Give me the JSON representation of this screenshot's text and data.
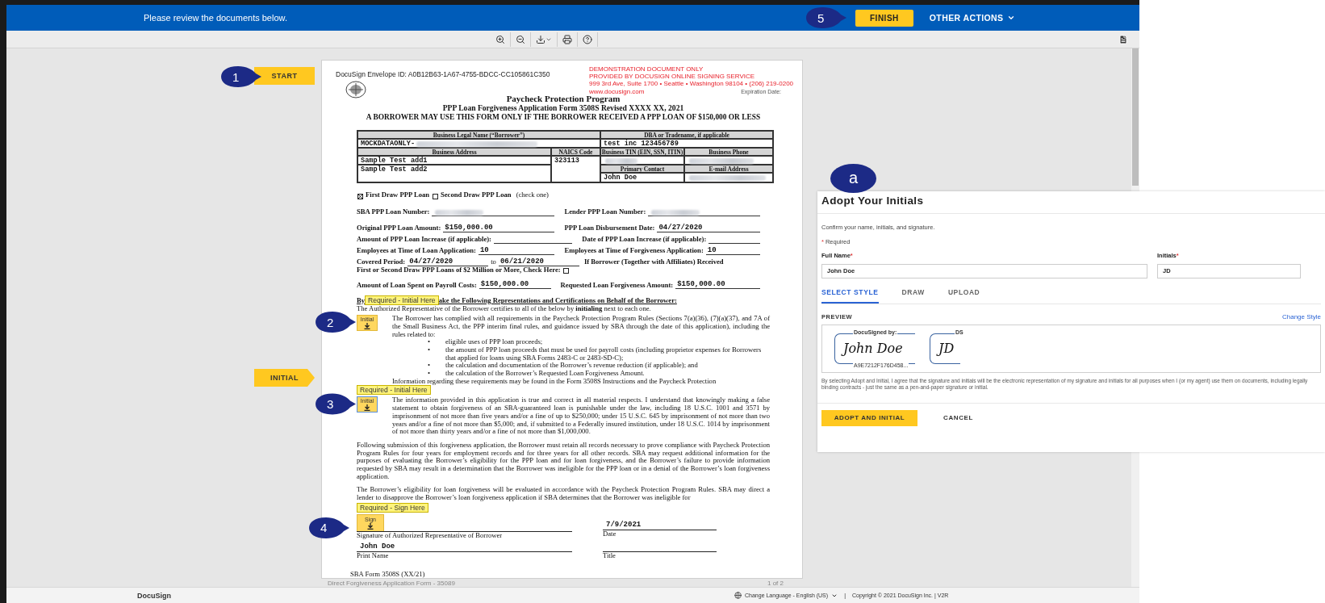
{
  "top_bar": {
    "message": "Please review the documents below.",
    "step": "5",
    "finish": "FINISH",
    "other_actions": "OTHER ACTIONS"
  },
  "side_markers": [
    {
      "step": "1",
      "tag": "START",
      "kind": "flat"
    },
    {
      "tag": "INITIAL",
      "kind": "arrow"
    }
  ],
  "document": {
    "envelope_id": "DocuSign Envelope ID: A0B12B63-1A67-4755-BDCC-CC105861C350",
    "demo_notice": [
      "DEMONSTRATION DOCUMENT ONLY",
      "PROVIDED BY DOCUSIGN ONLINE SIGNING SERVICE",
      "999 3rd Ave, Suite 1700 • Seattle • Washington 98104 • (206) 219-0200",
      "www.docusign.com"
    ],
    "expiration_label": "Expiration Date:",
    "title": "Paycheck Protection Program",
    "subtitle": "PPP Loan Forgiveness Application Form 3508S Revised XXXX XX, 2021",
    "notice": "A BORROWER MAY USE THIS FORM ONLY IF THE BORROWER RECEIVED A PPP LOAN OF $150,000 OR LESS",
    "business_table": {
      "legal_name_label": "Business Legal Name (“Borrower”)",
      "legal_name": {
        "text": "MOCKDATAONLY-",
        "blurred": true
      },
      "dba_label": "DBA or Tradename, if applicable",
      "dba": {
        "text": "test inc 123456789",
        "blurred": false
      },
      "address_label": "Business Address",
      "naics_label": "NAICS Code",
      "tin_label": "Business TIN (EIN, SSN, ITIN)",
      "phone_label": "Business Phone",
      "address_1": {
        "text": "Sample Test add1",
        "blurred": false
      },
      "address_2": {
        "text": "Sample Test add2",
        "blurred": false
      },
      "naics": {
        "text": "323113",
        "blurred": false
      },
      "tin": {
        "blurred": true
      },
      "phone": {
        "blurred": true
      },
      "contact_label": "Primary Contact",
      "email_label": "E-mail Address",
      "contact": {
        "text": "John Doe",
        "blurred": false
      },
      "email": {
        "blurred": true
      }
    },
    "loan_draw": [
      {
        "label": "First Draw PPP Loan",
        "checked": true
      },
      {
        "label": "Second Draw PPP Loan",
        "checked": false
      }
    ],
    "loan_draw_note": "(check one)",
    "field_rows": [
      [
        {
          "label": "SBA PPP Loan Number:",
          "blurred": true
        },
        {
          "label": "Lender PPP Loan Number:",
          "blurred": true
        }
      ],
      [
        {
          "label": "Original PPP Loan Amount:",
          "value": "$150,000.00",
          "blurred": false
        },
        {
          "label": "PPP Loan Disbursement Date:",
          "value": "04/27/2020",
          "blurred": false
        }
      ],
      [
        {
          "label": "Amount of PPP Loan Increase (if applicable):",
          "blurred": false
        },
        {
          "label": "Date of PPP Loan Increase (if applicable):",
          "blurred": false
        }
      ],
      [
        {
          "label": "Employees at Time of Loan Application:",
          "value": "10",
          "blurred": false
        },
        {
          "label": "Employees at Time of Forgiveness Application:",
          "value": "10",
          "blurred": false
        }
      ]
    ],
    "covered_period": {
      "label": "Covered Period:",
      "from": "04/27/2020",
      "to_word": "to",
      "to": "06/21/2020",
      "affiliates_line_1": "If Borrower (Together with Affiliates) Received",
      "affiliates_line_2": "First or Second Draw PPP Loans of $2 Million or More, Check Here:",
      "affiliates_checked": false
    },
    "amount_row": [
      {
        "label": "Amount of Loan Spent on Payroll Costs:",
        "value": "$150,000.00",
        "blurred": false
      },
      {
        "label": "Requested Loan Forgiveness Amount:",
        "value": "$150,000.00",
        "blurred": false
      }
    ],
    "certification_heading": [
      "By",
      "ake the Following Representations and Certifications on Behalf of the Borrower:"
    ],
    "heading_tag": "Required - Initial Here",
    "certification_intro": "The Authorized Representative of the Borrower certifies to all of the below by **initialing** next to each one.",
    "statement_1": {
      "step": "2",
      "tab_label": "Initial",
      "text": "The Borrower has complied with all requirements in the Paycheck Protection Program Rules (Sections 7(a)(36), (7)(a)(37), and 7A of the Small Business Act, the PPP interim final rules, and guidance issued by SBA through the date of this application), including the rules related to:",
      "tab_current": false,
      "bullets": [
        {
          "marker": "•",
          "text": "eligible uses of PPP loan proceeds;"
        },
        {
          "marker": "•",
          "text": "the amount of PPP loan proceeds that must be used for payroll costs (including proprietor expenses for Borrowers that applied for loans using SBA Forms 2483-C or 2483-SD-C);"
        },
        {
          "marker": "•",
          "text": "the calculation and documentation of the Borrower’s revenue reduction (if applicable); and"
        },
        {
          "marker": "•",
          "text": "the calculation of the Borrower’s Requested Loan Forgiveness Amount."
        }
      ],
      "info": "Information regarding these requirements may be found in the Form 3508S Instructions and the Paycheck Protection"
    },
    "statement_2": {
      "step": "3",
      "tag": "Required - Initial Here",
      "tab_label": "Initial",
      "tab_current": true,
      "text": "The information provided in this application is true and correct in all material respects.  I understand that knowingly making a false statement to obtain forgiveness of an SBA-guaranteed loan is punishable under the law, including 18 U.S.C. 1001 and 3571 by imprisonment of not more than five years and/or a fine of up to $250,000; under 15 U.S.C. 645 by imprisonment of not more than two years and/or a fine of not more than $5,000; and, if submitted to a Federally insured institution, under 18 U.S.C. 1014 by imprisonment of not more than thirty years and/or a fine of not more than $1,000,000."
    },
    "paragraphs": [
      "Following submission of this forgiveness application, the Borrower must retain all records necessary to prove compliance with Paycheck Protection Program Rules for four years for employment records and for three years for all other records.  SBA may request additional information for the purposes of evaluating the Borrower’s eligibility for the PPP loan and for loan forgiveness, and the Borrower’s failure to provide information requested by SBA may result in a determination that the Borrower was ineligible for the PPP loan or in a denial of the Borrower’s loan forgiveness application.",
      "The Borrower’s eligibility for loan forgiveness will be evaluated in accordance with the Paycheck Protection Program Rules.  SBA may direct a lender to disapprove the Borrower’s loan forgiveness application if SBA determines that the Borrower was ineligible for"
    ],
    "signature": {
      "step": "4",
      "tag": "Required - Sign Here",
      "tab_label": "Sign",
      "tab_current": false,
      "date": "7/9/2021",
      "signature_label": "Signature of Authorized Representative of  Borrower",
      "date_label": "Date",
      "print_name": "John Doe",
      "print_name_label": "Print Name",
      "title_label": "Title"
    },
    "form_footer": "SBA Form 3508S (XX/21)"
  },
  "page_footer": {
    "name": "Direct Forgiveness Application Form - 35089",
    "page": "1 of 2"
  },
  "dialog": {
    "badge": "a",
    "title": "Adopt Your Initials",
    "intro": "Confirm your name, initials, and signature.",
    "required_note": {
      "mark": "*",
      "text": "Required"
    },
    "fields": [
      {
        "label": "Full Name",
        "mark": "*",
        "value": "John Doe"
      },
      {
        "label": "Initials",
        "mark": "*",
        "value": "JD"
      }
    ],
    "tabs": [
      {
        "label": "SELECT STYLE",
        "selected": true
      },
      {
        "label": "DRAW",
        "selected": false
      },
      {
        "label": "UPLOAD",
        "selected": false
      }
    ],
    "preview_label": "PREVIEW",
    "change_style": "Change Style",
    "signature_preview": {
      "caption": "DocuSigned by:",
      "signature": "John Doe",
      "id": "A9E7212F176D458..."
    },
    "initials_preview": {
      "caption": "DS",
      "initials": "JD"
    },
    "legal_text": "By selecting Adopt and Initial, I agree that the signature and initials will be the electronic representation of my signature and initials for all purposes when I (or my agent) use them on documents, including legally binding contracts - just the same as a pen-and-paper signature or initial.",
    "buttons": [
      {
        "label": "ADOPT AND INITIAL",
        "kind": "primary"
      },
      {
        "label": "CANCEL",
        "kind": "plain"
      }
    ]
  },
  "footer": {
    "brand": "DocuSign",
    "language": "Change Language - English (US)",
    "separator": "|",
    "copyright": "Copyright © 2021 DocuSign Inc.  |  V2R"
  }
}
